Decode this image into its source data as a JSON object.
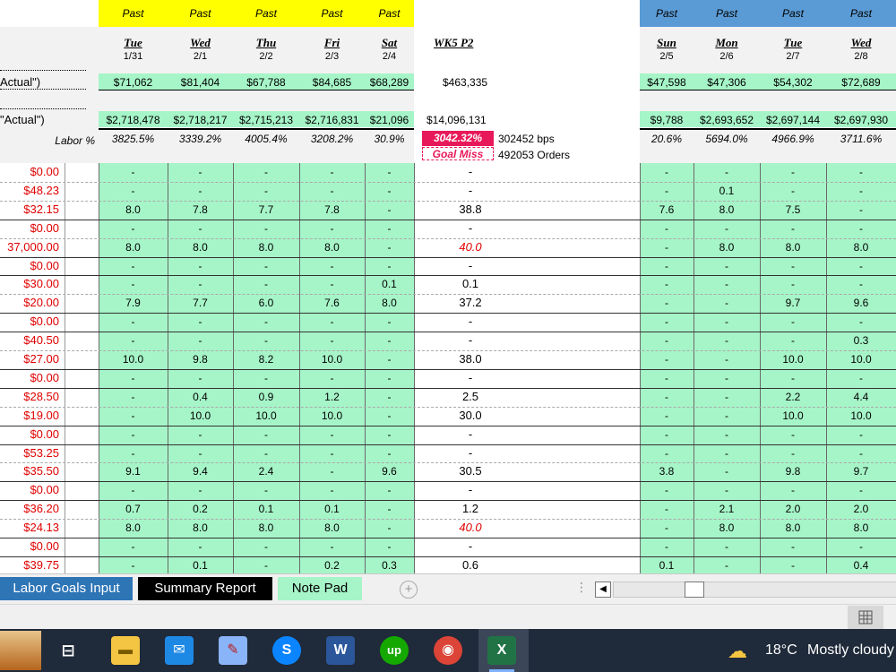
{
  "header": {
    "past_label": "Past",
    "days_left": [
      {
        "day": "Tue",
        "date": "1/31",
        "sales": "$71,062",
        "actual": "$2,718,478",
        "labor": "3825.5%"
      },
      {
        "day": "Wed",
        "date": "2/1",
        "sales": "$81,404",
        "actual": "$2,718,217",
        "labor": "3339.2%"
      },
      {
        "day": "Thu",
        "date": "2/2",
        "sales": "$67,788",
        "actual": "$2,715,213",
        "labor": "4005.4%"
      },
      {
        "day": "Fri",
        "date": "2/3",
        "sales": "$84,685",
        "actual": "$2,716,831",
        "labor": "3208.2%"
      },
      {
        "day": "Sat",
        "date": "2/4",
        "sales": "$68,289",
        "actual": "$21,096",
        "labor": "30.9%"
      }
    ],
    "days_right": [
      {
        "day": "Sun",
        "date": "2/5",
        "sales": "$47,598",
        "actual": "$9,788",
        "labor": "20.6%"
      },
      {
        "day": "Mon",
        "date": "2/6",
        "sales": "$47,306",
        "actual": "$2,693,652",
        "labor": "5694.0%"
      },
      {
        "day": "Tue",
        "date": "2/7",
        "sales": "$54,302",
        "actual": "$2,697,144",
        "labor": "4966.9%"
      },
      {
        "day": "Wed",
        "date": "2/8",
        "sales": "$72,689",
        "actual": "$2,697,930",
        "labor": "3711.6%"
      }
    ],
    "week_label": "WK5 P2",
    "week_sales": "$463,335",
    "week_actual": "$14,096,131",
    "week_labor": "3042.32%",
    "bps": "302452 bps",
    "goal_miss": "Goal Miss",
    "orders": "492053 Orders",
    "row_label_1": "Actual\")",
    "row_label_2": "\"Actual\")",
    "labor_label": "Labor %"
  },
  "rows": [
    {
      "rate": "$0.00",
      "left": [
        "-",
        "-",
        "-",
        "-",
        "-"
      ],
      "total": "-",
      "red": false,
      "right": [
        "-",
        "-",
        "-",
        "-"
      ]
    },
    {
      "rate": "$48.23",
      "left": [
        "-",
        "-",
        "-",
        "-",
        "-"
      ],
      "total": "-",
      "red": false,
      "right": [
        "-",
        "0.1",
        "-",
        "-"
      ]
    },
    {
      "rate": "$32.15",
      "left": [
        "8.0",
        "7.8",
        "7.7",
        "7.8",
        "-"
      ],
      "total": "38.8",
      "red": false,
      "right": [
        "7.6",
        "8.0",
        "7.5",
        "-"
      ]
    },
    {
      "rate": "$0.00",
      "left": [
        "-",
        "-",
        "-",
        "-",
        "-"
      ],
      "total": "-",
      "red": false,
      "right": [
        "-",
        "-",
        "-",
        "-"
      ]
    },
    {
      "rate": "37,000.00",
      "left": [
        "8.0",
        "8.0",
        "8.0",
        "8.0",
        "-"
      ],
      "total": "40.0",
      "red": true,
      "right": [
        "-",
        "8.0",
        "8.0",
        "8.0"
      ]
    },
    {
      "rate": "$0.00",
      "left": [
        "-",
        "-",
        "-",
        "-",
        "-"
      ],
      "total": "-",
      "red": false,
      "right": [
        "-",
        "-",
        "-",
        "-"
      ]
    },
    {
      "rate": "$30.00",
      "left": [
        "-",
        "-",
        "-",
        "-",
        "0.1"
      ],
      "total": "0.1",
      "red": false,
      "right": [
        "-",
        "-",
        "-",
        "-"
      ]
    },
    {
      "rate": "$20.00",
      "left": [
        "7.9",
        "7.7",
        "6.0",
        "7.6",
        "8.0"
      ],
      "total": "37.2",
      "red": false,
      "right": [
        "-",
        "-",
        "9.7",
        "9.6"
      ]
    },
    {
      "rate": "$0.00",
      "left": [
        "-",
        "-",
        "-",
        "-",
        "-"
      ],
      "total": "-",
      "red": false,
      "right": [
        "-",
        "-",
        "-",
        "-"
      ]
    },
    {
      "rate": "$40.50",
      "left": [
        "-",
        "-",
        "-",
        "-",
        "-"
      ],
      "total": "-",
      "red": false,
      "right": [
        "-",
        "-",
        "-",
        "0.3"
      ]
    },
    {
      "rate": "$27.00",
      "left": [
        "10.0",
        "9.8",
        "8.2",
        "10.0",
        "-"
      ],
      "total": "38.0",
      "red": false,
      "right": [
        "-",
        "-",
        "10.0",
        "10.0"
      ]
    },
    {
      "rate": "$0.00",
      "left": [
        "-",
        "-",
        "-",
        "-",
        "-"
      ],
      "total": "-",
      "red": false,
      "right": [
        "-",
        "-",
        "-",
        "-"
      ]
    },
    {
      "rate": "$28.50",
      "left": [
        "-",
        "0.4",
        "0.9",
        "1.2",
        "-"
      ],
      "total": "2.5",
      "red": false,
      "right": [
        "-",
        "-",
        "2.2",
        "4.4"
      ]
    },
    {
      "rate": "$19.00",
      "left": [
        "-",
        "10.0",
        "10.0",
        "10.0",
        "-"
      ],
      "total": "30.0",
      "red": false,
      "right": [
        "-",
        "-",
        "10.0",
        "10.0"
      ]
    },
    {
      "rate": "$0.00",
      "left": [
        "-",
        "-",
        "-",
        "-",
        "-"
      ],
      "total": "-",
      "red": false,
      "right": [
        "-",
        "-",
        "-",
        "-"
      ]
    },
    {
      "rate": "$53.25",
      "left": [
        "-",
        "-",
        "-",
        "-",
        "-"
      ],
      "total": "-",
      "red": false,
      "right": [
        "-",
        "-",
        "-",
        "-"
      ]
    },
    {
      "rate": "$35.50",
      "left": [
        "9.1",
        "9.4",
        "2.4",
        "-",
        "9.6"
      ],
      "total": "30.5",
      "red": false,
      "right": [
        "3.8",
        "-",
        "9.8",
        "9.7"
      ]
    },
    {
      "rate": "$0.00",
      "left": [
        "-",
        "-",
        "-",
        "-",
        "-"
      ],
      "total": "-",
      "red": false,
      "right": [
        "-",
        "-",
        "-",
        "-"
      ]
    },
    {
      "rate": "$36.20",
      "left": [
        "0.7",
        "0.2",
        "0.1",
        "0.1",
        "-"
      ],
      "total": "1.2",
      "red": false,
      "right": [
        "-",
        "2.1",
        "2.0",
        "2.0"
      ]
    },
    {
      "rate": "$24.13",
      "left": [
        "8.0",
        "8.0",
        "8.0",
        "8.0",
        "-"
      ],
      "total": "40.0",
      "red": true,
      "right": [
        "-",
        "8.0",
        "8.0",
        "8.0"
      ]
    },
    {
      "rate": "$0.00",
      "left": [
        "-",
        "-",
        "-",
        "-",
        "-"
      ],
      "total": "-",
      "red": false,
      "right": [
        "-",
        "-",
        "-",
        "-"
      ]
    },
    {
      "rate": "$39.75",
      "left": [
        "-",
        "0.1",
        "-",
        "0.2",
        "0.3"
      ],
      "total": "0.6",
      "red": false,
      "right": [
        "0.1",
        "-",
        "-",
        "0.4"
      ]
    }
  ],
  "tabs": {
    "labor_goals": "Labor Goals Input",
    "summary": "Summary Report",
    "notepad": "Note Pad",
    "add": "+"
  },
  "taskbar": {
    "temp": "18°C",
    "weather": "Mostly cloudy"
  },
  "colors": {
    "green": "#a6f5c8",
    "yellow": "#ffff00",
    "blue": "#5b9bd5",
    "goal_pink": "#e8195a",
    "rate_red": "#e00000"
  }
}
